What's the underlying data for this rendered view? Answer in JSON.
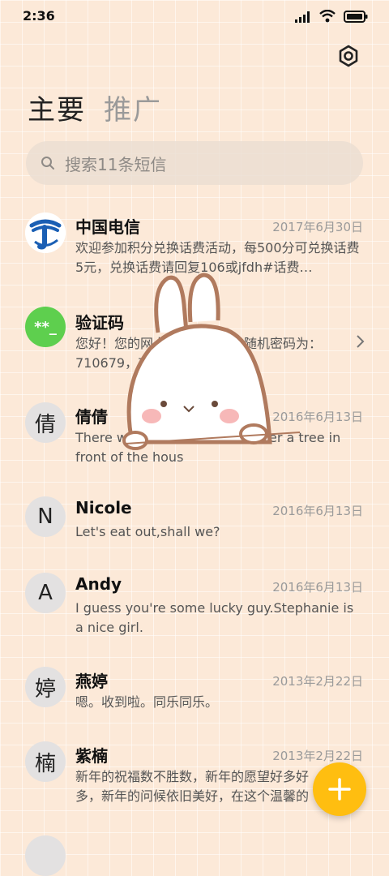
{
  "status_bar": {
    "time": "2:36"
  },
  "tabs": [
    {
      "label": "主要"
    },
    {
      "label": "推广"
    }
  ],
  "search": {
    "placeholder": "搜索11条短信"
  },
  "conversations": [
    {
      "name": "中国电信",
      "date": "2017年6月30日",
      "snippet": "欢迎参加积分兑换话费活动，每500分可兑换话费5元，兑换话费请回复106或jfdh#话费…",
      "avatar": "telecom-logo"
    },
    {
      "name": "验证码",
      "date": "",
      "snippet": "您好！您的网上营业厅登录的随机密码为：710679，有效时间为3分钟",
      "avatar": "**_"
    },
    {
      "name": "倩倩",
      "date": "2016年6月13日",
      "snippet": "There was a table set out under a tree in front of the hous",
      "avatar": "倩"
    },
    {
      "name": "Nicole",
      "date": "2016年6月13日",
      "snippet": "Let's eat out,shall we?",
      "avatar": "N"
    },
    {
      "name": "Andy",
      "date": "2016年6月13日",
      "snippet": "I guess you're some lucky guy.Stephanie is a nice girl.",
      "avatar": "A"
    },
    {
      "name": "燕婷",
      "date": "2013年2月22日",
      "snippet": "嗯。收到啦。同乐同乐。",
      "avatar": "婷"
    },
    {
      "name": "紫楠",
      "date": "2013年2月22日",
      "snippet": "新年的祝福数不胜数，新年的愿望好多好多，新年的问候依旧美好，在这个温馨的时刻",
      "avatar": "楠"
    }
  ],
  "colors": {
    "background": "#fce9d8",
    "fab": "#ffbe10",
    "verify_avatar": "#5ecf4e",
    "telecom_blue": "#1a5fb4"
  }
}
